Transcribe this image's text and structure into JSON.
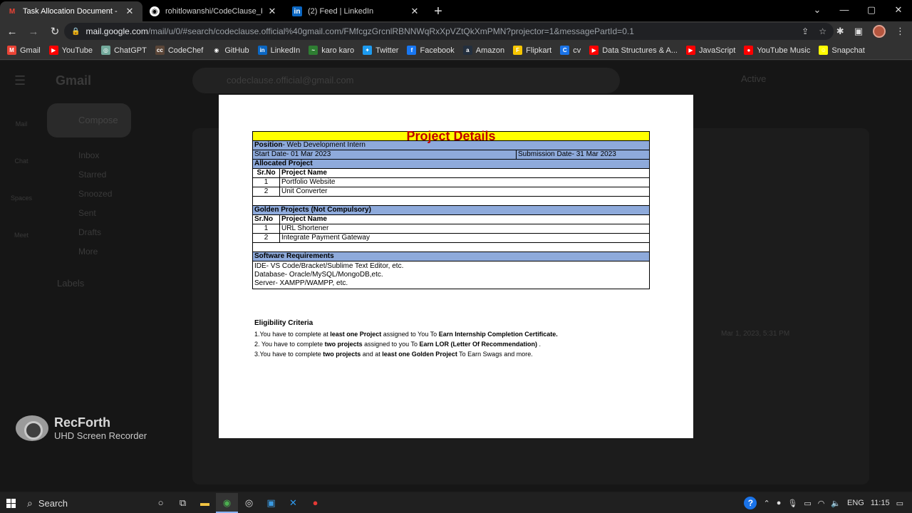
{
  "browser": {
    "tabs": [
      {
        "title": "Task Allocation Document - rohi",
        "icon": "gmail-icon",
        "active": true
      },
      {
        "title": "rohitlowanshi/CodeClause_Portf",
        "icon": "github-icon",
        "active": false
      },
      {
        "title": "(2) Feed | LinkedIn",
        "icon": "linkedin-icon",
        "active": false
      }
    ],
    "url_host": "mail.google.com",
    "url_path": "/mail/u/0/#search/codeclause.official%40gmail.com/FMfcgzGrcnlRBNNWqRxXpVZtQkXmPMN?projector=1&messagePartId=0.1"
  },
  "bookmarks": [
    {
      "label": "Gmail",
      "color": "#ea4335",
      "glyph": "M"
    },
    {
      "label": "YouTube",
      "color": "#ff0000",
      "glyph": "▶"
    },
    {
      "label": "ChatGPT",
      "color": "#74aa9c",
      "glyph": "◎"
    },
    {
      "label": "CodeChef",
      "color": "#5b4638",
      "glyph": "cc"
    },
    {
      "label": "GitHub",
      "color": "#333333",
      "glyph": "◉"
    },
    {
      "label": "LinkedIn",
      "color": "#0a66c2",
      "glyph": "in"
    },
    {
      "label": "karo karo",
      "color": "#2e7d32",
      "glyph": "~"
    },
    {
      "label": "Twitter",
      "color": "#1d9bf0",
      "glyph": "✦"
    },
    {
      "label": "Facebook",
      "color": "#1877f2",
      "glyph": "f"
    },
    {
      "label": "Amazon",
      "color": "#232f3e",
      "glyph": "a"
    },
    {
      "label": "Flipkart",
      "color": "#f7c600",
      "glyph": "F"
    },
    {
      "label": "cv",
      "color": "#1a73e8",
      "glyph": "C"
    },
    {
      "label": "Data Structures & A...",
      "color": "#ff0000",
      "glyph": "▶"
    },
    {
      "label": "JavaScript",
      "color": "#ff0000",
      "glyph": "▶"
    },
    {
      "label": "YouTube Music",
      "color": "#ff0000",
      "glyph": "●"
    },
    {
      "label": "Snapchat",
      "color": "#fffc00",
      "glyph": "☺"
    }
  ],
  "gmail": {
    "logo": "Gmail",
    "search_value": "codeclause.official@gmail.com",
    "status": "Active",
    "compose": "Compose",
    "rail": [
      "Mail",
      "Chat",
      "Spaces",
      "Meet"
    ],
    "nav": [
      "Inbox",
      "Starred",
      "Snoozed",
      "Sent",
      "Drafts",
      "More"
    ],
    "labels": "Labels",
    "message_date": "Mar 1, 2023, 5:31 PM"
  },
  "document": {
    "title": "Project Details",
    "position_label": "Position",
    "position_value": "- Web Development Intern",
    "start_date": "Start Date- 01 Mar 2023",
    "submission_date": "Submission Date- 31 Mar 2023",
    "allocated_heading": "Allocated Project",
    "col_srno": "Sr.No",
    "col_name": "Project Name",
    "allocated": [
      {
        "no": "1",
        "name": "Portfolio Website"
      },
      {
        "no": "2",
        "name": "Unit Converter"
      }
    ],
    "golden_heading": "Golden Projects (Not Compulsory)",
    "golden": [
      {
        "no": "1",
        "name": "URL Shortener"
      },
      {
        "no": "2",
        "name": "Integrate Payment Gateway"
      }
    ],
    "software_heading": "Software Requirements",
    "software": [
      "IDE- VS Code/Bracket/Sublime Text Editor, etc.",
      "Database- Oracle/MySQL/MongoDB,etc.",
      "Server- XAMPP/WAMPP, etc."
    ],
    "eligibility_heading": "Eligibility Criteria",
    "eligibility": [
      {
        "pre": "1.You have to complete at ",
        "b1": "least one Project",
        "mid": " assigned to You To ",
        "b2": "Earn Internship Completion Certificate.",
        "post": ""
      },
      {
        "pre": "2. You have to complete ",
        "b1": "two projects",
        "mid": " assigned to you To ",
        "b2": "Earn LOR (Letter Of Recommendation)",
        "post": " ."
      },
      {
        "pre": "3.You have to complete ",
        "b1": "two projects",
        "mid": " and at ",
        "b2": "least one Golden Project",
        "post": " To Earn Swags and more."
      }
    ]
  },
  "watermark": {
    "title": "RecForth",
    "subtitle": "UHD Screen Recorder"
  },
  "taskbar": {
    "search": "Search",
    "lang": "ENG",
    "time": "11:15"
  }
}
